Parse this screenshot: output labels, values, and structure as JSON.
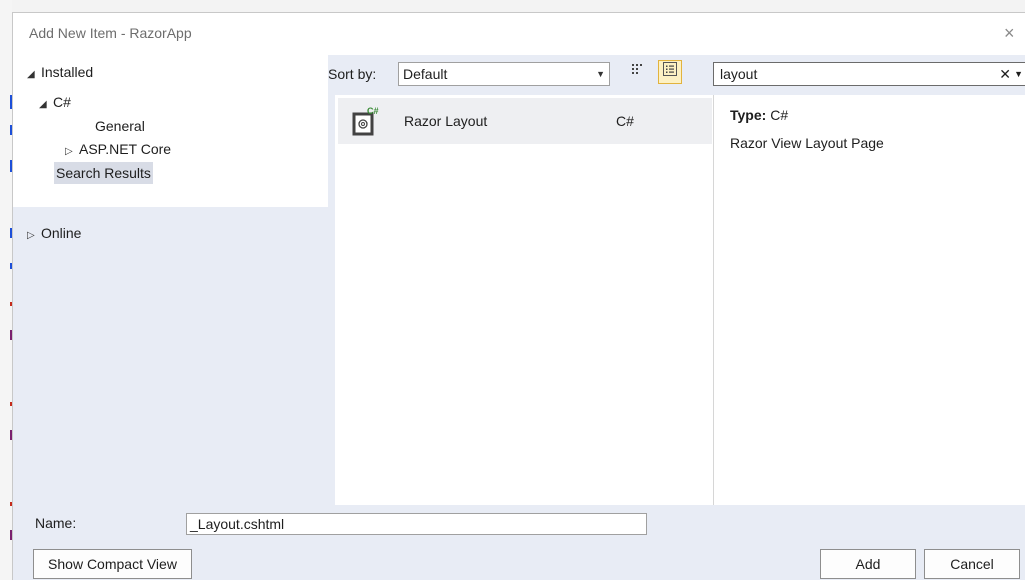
{
  "dialog": {
    "title": "Add New Item - RazorApp",
    "close_glyph": "×"
  },
  "tree": {
    "installed": "Installed",
    "csharp": "C#",
    "general": "General",
    "aspnet_core": "ASP.NET Core",
    "search_results": "Search Results",
    "online": "Online",
    "expanded_glyph": "◢",
    "collapsed_glyph": "▷"
  },
  "toolbar": {
    "sort_label": "Sort by:",
    "sort_value": "Default",
    "dropdown_glyph": "▼",
    "grid_view_icon": "grid-view-icon",
    "list_view_icon": "list-view-icon"
  },
  "search": {
    "value": "layout",
    "clear_glyph": "✕",
    "dropdown_glyph": "▼"
  },
  "templates": [
    {
      "name": "Razor Layout",
      "language": "C#",
      "icon": "razor-file-icon",
      "icon_badge": "C#"
    }
  ],
  "detail": {
    "type_label": "Type:",
    "type_value": "C#",
    "description": "Razor View Layout Page"
  },
  "footer": {
    "name_label": "Name:",
    "name_value": "_Layout.cshtml",
    "compact_button": "Show Compact View",
    "add_button": "Add",
    "cancel_button": "Cancel"
  },
  "colors": {
    "dialog_bg": "#e8ecf5",
    "active_view_bg": "#fdf1c3",
    "selected_item_bg": "#eeeff2",
    "csharp_badge": "#388a34"
  }
}
